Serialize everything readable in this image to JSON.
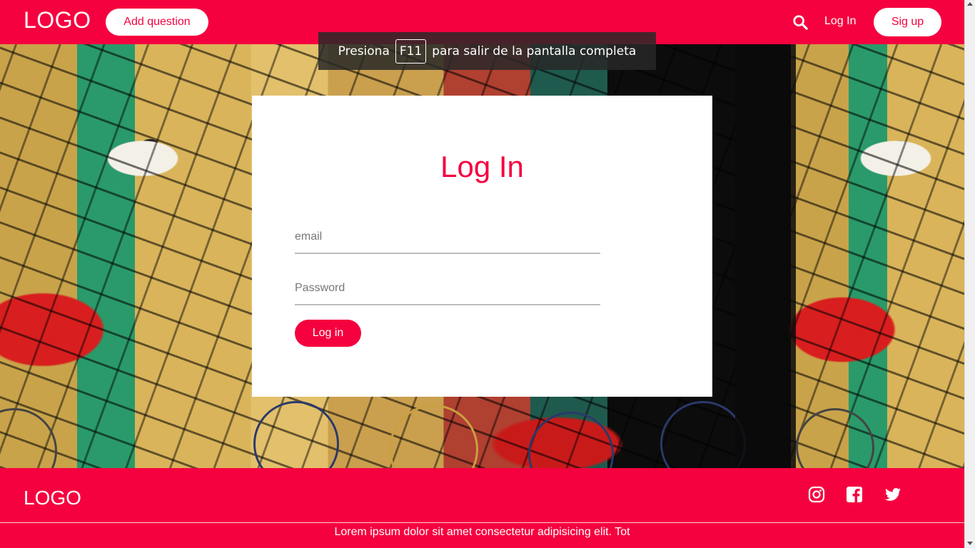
{
  "header": {
    "logo": "LOGO",
    "add_question": "Add question",
    "login_link": "Log In",
    "signup": "Sig up"
  },
  "fullscreen_notice": {
    "before": "Presiona",
    "key": "F11",
    "after": "para salir de la pantalla completa"
  },
  "login_form": {
    "title": "Log In",
    "email_placeholder": "email",
    "password_placeholder": "Password",
    "submit": "Log in"
  },
  "footer": {
    "logo": "LOGO",
    "text": "Lorem ipsum dolor sit amet consectetur adipisicing elit. Tot",
    "social": [
      "instagram-icon",
      "facebook-icon",
      "twitter-icon"
    ]
  },
  "colors": {
    "brand": "#f5013f",
    "white": "#ffffff"
  }
}
